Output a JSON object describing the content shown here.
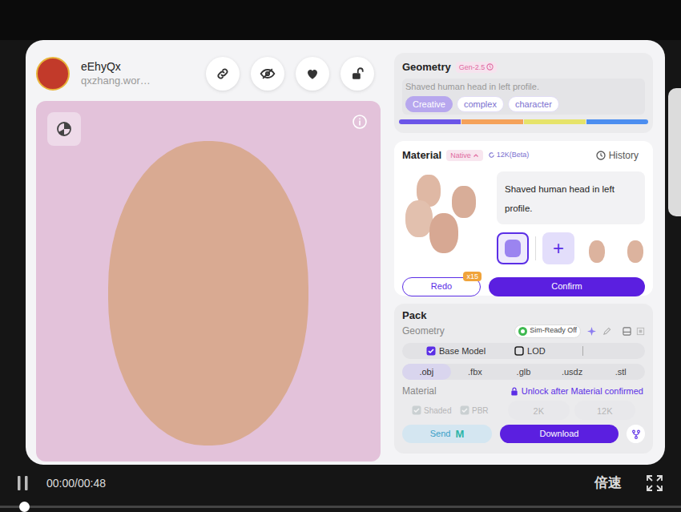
{
  "user": {
    "name": "eEhyQx",
    "handle": "qxzhang.wor…"
  },
  "geometry": {
    "title": "Geometry",
    "model": "Gen-2.5",
    "prompt": "Shaved human head in left profile.",
    "tags": [
      {
        "label": "Creative",
        "selected": true
      },
      {
        "label": "complex",
        "selected": false
      },
      {
        "label": "character",
        "selected": false
      }
    ],
    "style_bar": [
      {
        "color": "#6b55e8"
      },
      {
        "color": "#f5a25a"
      },
      {
        "color": "#e6e36a"
      },
      {
        "color": "#4c8ef0"
      }
    ]
  },
  "material": {
    "title": "Material",
    "mode": "Native",
    "resolution": "12K(Beta)",
    "history": "History",
    "prompt": "Shaved human head in left profile.",
    "variants": [
      {
        "kind": "generated",
        "selected": true
      },
      {
        "kind": "add",
        "label": "+",
        "selected": false
      },
      {
        "kind": "thumbnail",
        "selected": false
      },
      {
        "kind": "thumbnail",
        "selected": false
      }
    ],
    "redo": {
      "label": "Redo",
      "count": "x15"
    },
    "confirm": "Confirm"
  },
  "pack": {
    "title": "Pack",
    "geometry_label": "Geometry",
    "sim_ready": {
      "label": "Sim-Ready Off",
      "on": false
    },
    "options": [
      {
        "label": "Base Model",
        "checked": true
      },
      {
        "label": "LOD",
        "checked": false
      }
    ],
    "formats": [
      {
        "label": ".obj",
        "selected": true
      },
      {
        "label": ".fbx",
        "selected": false
      },
      {
        "label": ".glb",
        "selected": false
      },
      {
        "label": ".usdz",
        "selected": false
      },
      {
        "label": ".stl",
        "selected": false
      }
    ],
    "material_label": "Material",
    "lock_note": "Unlock after Material confirmed",
    "material_options": [
      {
        "label": "Shaded",
        "kind": "checkbox",
        "checked": true,
        "disabled": true
      },
      {
        "label": "PBR",
        "kind": "checkbox",
        "checked": true,
        "disabled": true
      },
      {
        "label": "2K",
        "kind": "resolution",
        "disabled": true
      },
      {
        "label": "12K",
        "kind": "resolution",
        "disabled": true
      }
    ],
    "send": {
      "label": "Send",
      "logo": "M"
    },
    "download": "Download"
  },
  "player": {
    "playing": true,
    "time": "00:00/00:48",
    "speed": "倍速",
    "progress": 0
  }
}
